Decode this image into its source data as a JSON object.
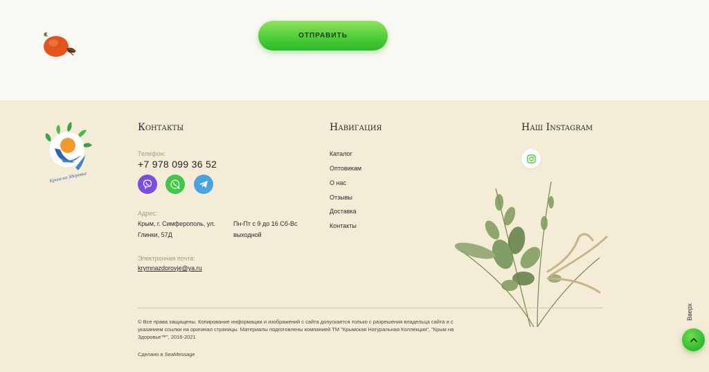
{
  "form": {
    "submit_label": "ОТПРАВИТЬ"
  },
  "footer": {
    "logo_text": "Крым на Здоровье",
    "contacts": {
      "title": "Контакты",
      "phone_label": "Телефон:",
      "phone": "+7 978 099 36 52",
      "socials": [
        "viber-icon",
        "whatsapp-icon",
        "telegram-icon"
      ],
      "address_label": "Адрес:",
      "address": "Крым, г. Симферополь, ул. Глинки, 57Д",
      "hours": "Пн-Пт с 9 до 16 Сб-Вс выходной",
      "email_label": "Электронная почта:",
      "email": "krymnazdorovje@ya.ru"
    },
    "navigation": {
      "title": "Навигация",
      "items": [
        "Каталог",
        "Оптовикам",
        "О нас",
        "Отзывы",
        "Доставка",
        "Контакты"
      ]
    },
    "instagram": {
      "title": "Наш Instagram"
    },
    "copyright": "© Все права защищены. Копирование информации и изображений с сайта допускается только с разрешения владельца сайта и с указанием ссылки на оригинал страницы. Материалы подготовлены компанией ТМ \"Крымская Натуральная Коллекция\", \"Крым на Здоровье™\", 2016-2021",
    "made_by": "Сделано в SeaMessage",
    "scroll_up_label": "Вверх"
  },
  "colors": {
    "accent_green": "#4fce39",
    "footer_bg": "#f4ecd6",
    "page_bg": "#faf8f3",
    "viber": "#7a4fe0",
    "whatsapp": "#3fc746",
    "telegram": "#4aa3df"
  }
}
